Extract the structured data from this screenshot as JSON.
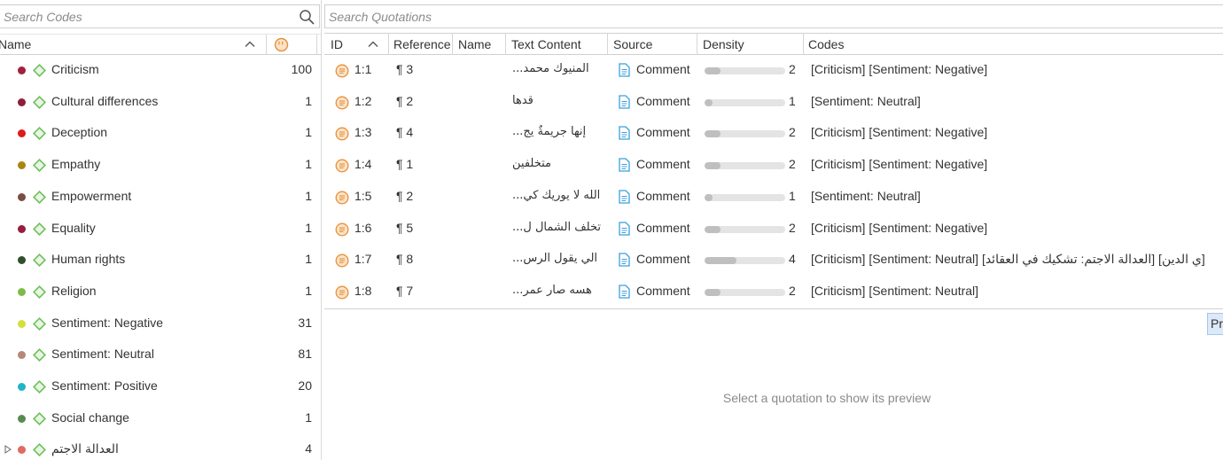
{
  "codes_pane": {
    "search_placeholder": "Search Codes",
    "header": {
      "name_label": "Name"
    },
    "items": [
      {
        "label": "Criticism",
        "count": "100",
        "color": "#a31f3c"
      },
      {
        "label": "Cultural differences",
        "count": "1",
        "color": "#8e1e3a"
      },
      {
        "label": "Deception",
        "count": "1",
        "color": "#e0191b"
      },
      {
        "label": "Empathy",
        "count": "1",
        "color": "#a8860f"
      },
      {
        "label": "Empowerment",
        "count": "1",
        "color": "#7a4e43"
      },
      {
        "label": "Equality",
        "count": "1",
        "color": "#9a1c3f"
      },
      {
        "label": "Human rights",
        "count": "1",
        "color": "#2f4f2a"
      },
      {
        "label": "Religion",
        "count": "1",
        "color": "#7dbb4a"
      },
      {
        "label": "Sentiment: Negative",
        "count": "31",
        "color": "#d6de3a"
      },
      {
        "label": "Sentiment: Neutral",
        "count": "81",
        "color": "#b7877a"
      },
      {
        "label": "Sentiment: Positive",
        "count": "20",
        "color": "#1fb5c6"
      },
      {
        "label": "Social change",
        "count": "1",
        "color": "#5a8a52"
      },
      {
        "label": "العدالة الاجتم",
        "count": "4",
        "color": "#e06b62",
        "expandable": true
      }
    ]
  },
  "quotations_pane": {
    "search_placeholder": "Search Quotations",
    "columns": [
      "ID",
      "Reference",
      "Name",
      "Text Content",
      "Source",
      "Density",
      "Codes"
    ],
    "rows": [
      {
        "id": "1:1",
        "reference": "¶ 3",
        "text": "المنيوك محمد...",
        "source": "Comment",
        "density": 2,
        "codes": "[Criticism] [Sentiment: Negative]"
      },
      {
        "id": "1:2",
        "reference": "¶ 2",
        "text": "قدها",
        "source": "Comment",
        "density": 1,
        "codes": "[Sentiment: Neutral]"
      },
      {
        "id": "1:3",
        "reference": "¶ 4",
        "text": "إنها جريمةٌ يج...",
        "source": "Comment",
        "density": 2,
        "codes": "[Criticism] [Sentiment: Negative]"
      },
      {
        "id": "1:4",
        "reference": "¶ 1",
        "text": "متخلفين",
        "source": "Comment",
        "density": 2,
        "codes": "[Criticism] [Sentiment: Negative]"
      },
      {
        "id": "1:5",
        "reference": "¶ 2",
        "text": "الله لا يوريك كي...",
        "source": "Comment",
        "density": 1,
        "codes": "[Sentiment: Neutral]"
      },
      {
        "id": "1:6",
        "reference": "¶ 5",
        "text": "تخلف الشمال ل...",
        "source": "Comment",
        "density": 2,
        "codes": "[Criticism] [Sentiment: Negative]"
      },
      {
        "id": "1:7",
        "reference": "¶ 8",
        "text": "الي يقول الرس...",
        "source": "Comment",
        "density": 4,
        "codes": "[Criticism] [Sentiment: Neutral] [العدالة الاجتم: تشكيك في العقائد] [ي الدين]"
      },
      {
        "id": "1:8",
        "reference": "¶ 7",
        "text": "هسه صار عمر...",
        "source": "Comment",
        "density": 2,
        "codes": "[Criticism] [Sentiment: Neutral]"
      }
    ],
    "density_max": 10
  },
  "preview": {
    "button_label": "Pr",
    "empty_message": "Select a quotation to show its preview"
  },
  "colors": {
    "quotation_icon": "#e8913a",
    "code_diamond": "#6dbf5a",
    "document_icon": "#3aa0dc",
    "density_fill": "#bfbfbf"
  }
}
